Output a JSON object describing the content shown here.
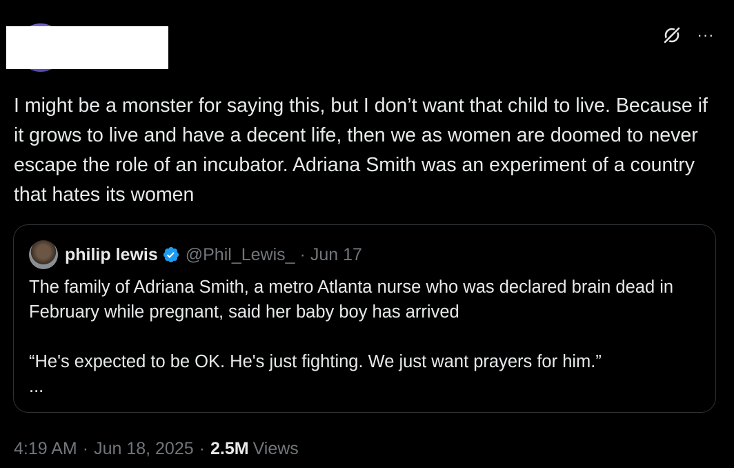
{
  "tweet": {
    "text": "I might be a monster for saying this, but I don’t want that child to live. Because if it grows to live and have a decent life, then we as women are doomed to never escape the role of an incubator. Adriana Smith was an experiment of a country that hates its women",
    "header_icons": {
      "grok": "grok-icon",
      "more": "more-horizontal-icon",
      "more_glyph": "···"
    },
    "meta": {
      "time": "4:19 AM",
      "sep1": "·",
      "date": "Jun 18, 2025",
      "sep2": "·",
      "views_count": "2.5M",
      "views_label": "Views"
    }
  },
  "quote": {
    "name": "philip lewis",
    "handle": "@Phil_Lewis_",
    "dot": "·",
    "date": "Jun 17",
    "text": "The family of Adriana Smith, a metro Atlanta nurse who was declared brain dead in February while pregnant, said her baby boy has arrived\n\n“He's expected to be OK. He's just fighting. We just want prayers for him.”\n...",
    "verified_icon": "verified-badge-icon",
    "verified_color": "#1d9bf0"
  },
  "colors": {
    "background": "#000000",
    "text": "#e7e9ea",
    "muted": "#71767b",
    "border": "#2f3336",
    "accent": "#1d9bf0"
  }
}
